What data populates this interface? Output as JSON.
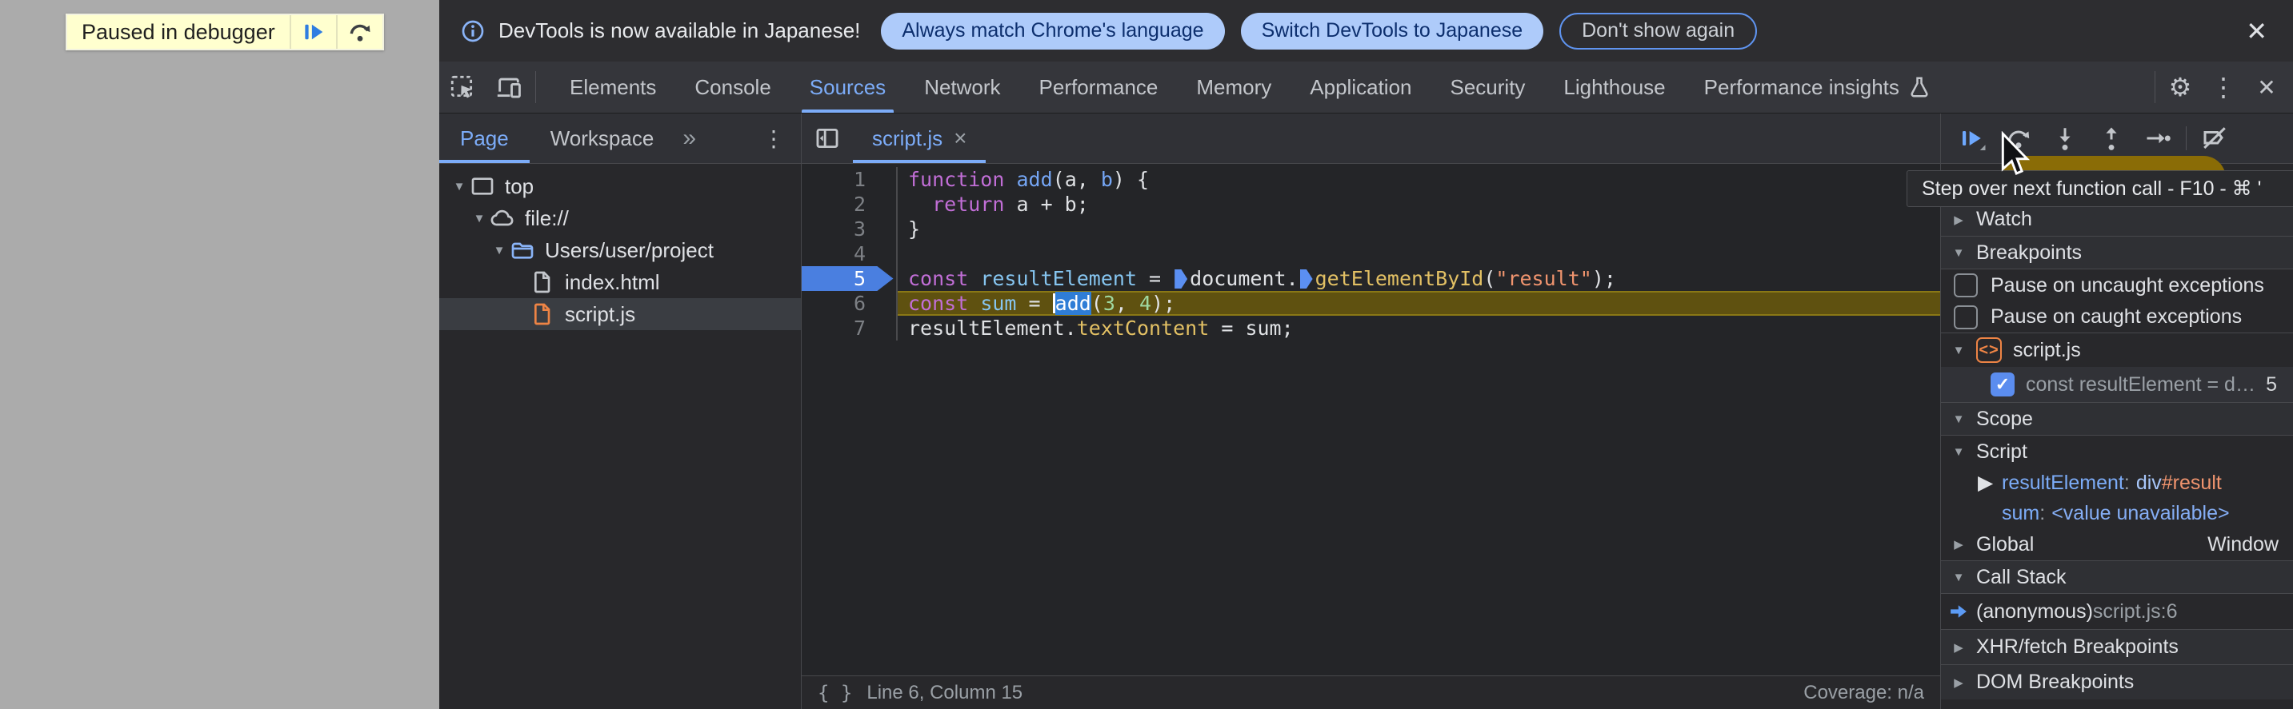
{
  "colors": {
    "accent_blue": "#7cacf8",
    "breakpoint_blue": "#4a7fe0",
    "paused_line_olive": "#5f5110",
    "string_orange": "#f0946e",
    "keyword_purple": "#c16ed6",
    "banner_yellow": "#ffffcf",
    "infobar_pill": "#aecbfa"
  },
  "overlay": {
    "paused_banner": {
      "label": "Paused in debugger"
    }
  },
  "infobar": {
    "message": "DevTools is now available in Japanese!",
    "action_primary": "Always match Chrome's language",
    "action_secondary": "Switch DevTools to Japanese",
    "action_dismiss": "Don't show again",
    "close_symbol": "✕"
  },
  "main_toolbar": {
    "tabs": [
      "Elements",
      "Console",
      "Sources",
      "Network",
      "Performance",
      "Memory",
      "Application",
      "Security",
      "Lighthouse",
      "Performance insights"
    ],
    "active_tab": "Sources",
    "gear_symbol": "⚙",
    "menu_symbol": "⋮",
    "close_symbol": "✕"
  },
  "nav": {
    "tabs": [
      "Page",
      "Workspace"
    ],
    "active_tab": "Page",
    "more_symbol": "»",
    "menu_symbol": "⋮",
    "tree": [
      {
        "label": "top",
        "icon": "frame-icon",
        "depth": 0,
        "expanded": true
      },
      {
        "label": "file://",
        "icon": "cloud-icon",
        "depth": 1,
        "expanded": true
      },
      {
        "label": "Users/user/project",
        "icon": "folder-icon",
        "depth": 2,
        "expanded": true
      },
      {
        "label": "index.html",
        "icon": "file-icon",
        "depth": 3
      },
      {
        "label": "script.js",
        "icon": "file-js-icon",
        "depth": 3,
        "selected": true
      }
    ]
  },
  "editor": {
    "tab_label": "script.js",
    "tab_close_symbol": "×",
    "breakpoint_line": 5,
    "paused_line": 6,
    "lines": [
      {
        "n": 1,
        "tokens": [
          {
            "t": "function",
            "c": "kw"
          },
          {
            "t": " ",
            "c": "pl"
          },
          {
            "t": "add",
            "c": "fn"
          },
          {
            "t": "(a, ",
            "c": "pl"
          },
          {
            "t": "b",
            "c": "fn"
          },
          {
            "t": ") {",
            "c": "pl"
          }
        ]
      },
      {
        "n": 2,
        "tokens": [
          {
            "t": "  ",
            "c": "pl"
          },
          {
            "t": "return",
            "c": "kw"
          },
          {
            "t": " a + b;",
            "c": "pl"
          }
        ]
      },
      {
        "n": 3,
        "tokens": [
          {
            "t": "}",
            "c": "pl"
          }
        ]
      },
      {
        "n": 4,
        "tokens": []
      },
      {
        "n": 5,
        "tokens": [
          {
            "t": "const",
            "c": "kw"
          },
          {
            "t": " ",
            "c": "pl"
          },
          {
            "t": "resultElement",
            "c": "var"
          },
          {
            "t": " = ",
            "c": "pl"
          },
          {
            "marker": true
          },
          {
            "t": "document.",
            "c": "pl"
          },
          {
            "marker": true
          },
          {
            "t": "getElementById",
            "c": "prop"
          },
          {
            "t": "(",
            "c": "pl"
          },
          {
            "t": "\"result\"",
            "c": "str"
          },
          {
            "t": ");",
            "c": "pl"
          }
        ]
      },
      {
        "n": 6,
        "tokens": [
          {
            "t": "const",
            "c": "kw"
          },
          {
            "t": " ",
            "c": "pl"
          },
          {
            "t": "sum",
            "c": "var"
          },
          {
            "t": " = ",
            "c": "pl"
          },
          {
            "caret": true
          },
          {
            "t": "add",
            "c": "callee"
          },
          {
            "t": "(",
            "c": "pl"
          },
          {
            "t": "3",
            "c": "num"
          },
          {
            "t": ", ",
            "c": "pl"
          },
          {
            "t": "4",
            "c": "num"
          },
          {
            "t": ");",
            "c": "pl"
          }
        ]
      },
      {
        "n": 7,
        "tokens": [
          {
            "t": "resultElement.",
            "c": "pl"
          },
          {
            "t": "textContent",
            "c": "prop"
          },
          {
            "t": " = sum;",
            "c": "pl"
          }
        ]
      }
    ],
    "status": {
      "braces": "{ }",
      "position": "Line 6, Column 15",
      "coverage": "Coverage: n/a"
    }
  },
  "debugger": {
    "tooltip": "Step over next function call - F10 - ⌘ '",
    "watch": {
      "label": "Watch"
    },
    "breakpoints": {
      "label": "Breakpoints",
      "pause_uncaught": "Pause on uncaught exceptions",
      "pause_caught": "Pause on caught exceptions",
      "file_group": "script.js",
      "badge_glyph": "<>",
      "entry": {
        "text": "const resultElement = doc⋯",
        "line": "5",
        "checked": true
      }
    },
    "scope": {
      "label": "Scope",
      "script_label": "Script",
      "vars": [
        {
          "key": "resultElement",
          "expandable": true,
          "value": [
            {
              "t": "div",
              "c": "v-blue"
            },
            {
              "t": "#result",
              "c": "v-orange"
            }
          ]
        },
        {
          "key": "sum",
          "expandable": false,
          "value": [
            {
              "t": "<value unavailable>",
              "c": "v-lblue"
            }
          ]
        }
      ],
      "global_label": "Global",
      "global_value": "Window"
    },
    "call_stack": {
      "label": "Call Stack",
      "frames": [
        {
          "name": "(anonymous)",
          "location": "script.js:6"
        }
      ]
    },
    "xhr": {
      "label": "XHR/fetch Breakpoints"
    },
    "dom": {
      "label": "DOM Breakpoints"
    }
  }
}
